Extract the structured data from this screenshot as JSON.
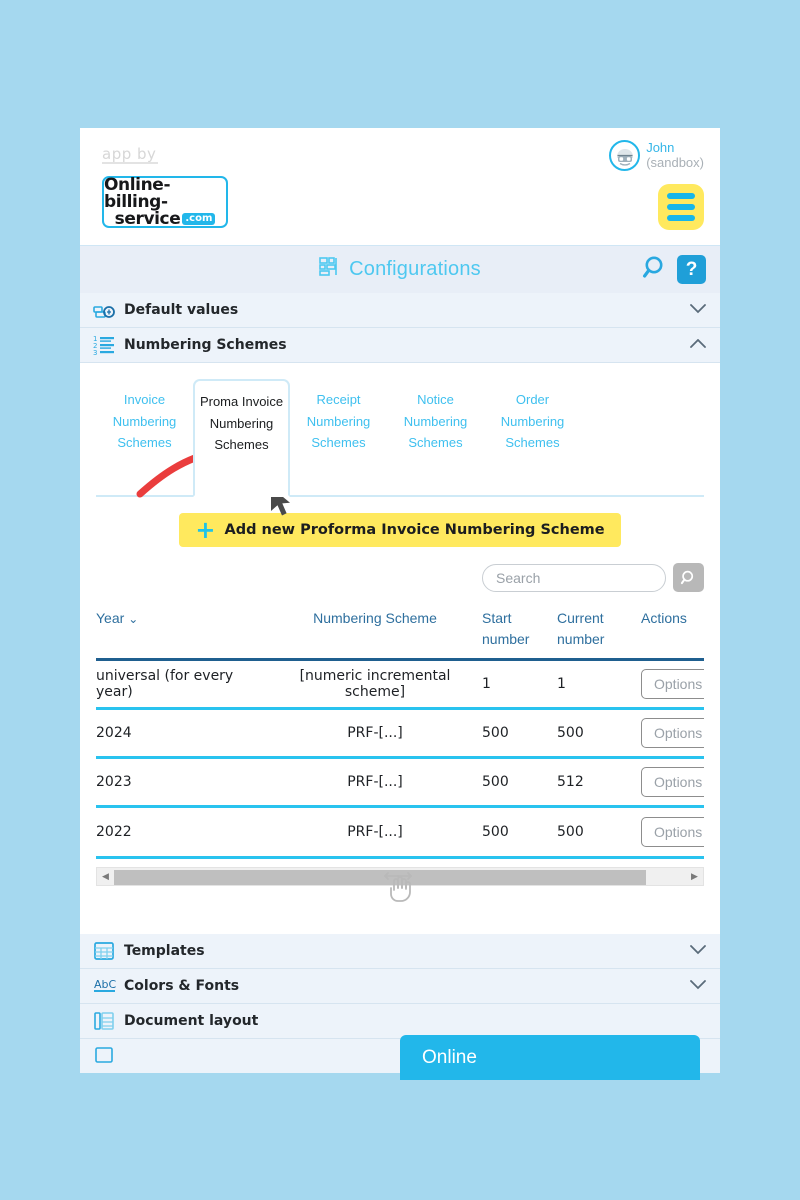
{
  "brand": {
    "app_by": "app by",
    "logo_line1": "Online-billing-",
    "logo_line2": "service",
    "logo_tld": ".com"
  },
  "user": {
    "name": "John",
    "mode": "(sandbox)",
    "avatar_icon": "user-face-icon",
    "menu_icon": "hamburger-menu-icon"
  },
  "configbar": {
    "title": "Configurations",
    "title_icon": "blocks-grid-icon",
    "search_icon": "magnifier-icon",
    "help_label": "?"
  },
  "sections": [
    {
      "label": "Default values",
      "icon": "default-values-icon",
      "expanded": false,
      "chevron": "⌄"
    },
    {
      "label": "Numbering Schemes",
      "icon": "numbered-list-icon",
      "expanded": true,
      "chevron": "⌃"
    },
    {
      "label": "Templates",
      "icon": "templates-grid-icon",
      "expanded": false,
      "chevron": "⌄"
    },
    {
      "label": "Colors & Fonts",
      "icon": "abc-colors-icon",
      "expanded": false,
      "chevron": "⌄"
    },
    {
      "label": "Document layout",
      "icon": "document-layout-icon",
      "expanded": false,
      "chevron": ""
    }
  ],
  "tabs": [
    {
      "label": "Invoice Numbering Schemes",
      "active": false
    },
    {
      "label": "Proma Invoice Numbering Schemes",
      "active": true
    },
    {
      "label": "Receipt Numbering Schemes",
      "active": false
    },
    {
      "label": "Notice Numbering Schemes",
      "active": false
    },
    {
      "label": "Order Numbering Schemes",
      "active": false
    }
  ],
  "add_button": {
    "label": "Add new Proforma Invoice Numbering Scheme",
    "icon": "plus-icon",
    "plus": "+"
  },
  "search": {
    "value": "",
    "placeholder": "Search",
    "button_icon": "magnifier-icon"
  },
  "table": {
    "headers": {
      "year": "Year",
      "scheme": "Numbering Scheme",
      "start": "Start number",
      "current": "Current number",
      "actions": "Actions"
    },
    "sort_caret": "⌄",
    "rows": [
      {
        "year": "universal (for every year)",
        "scheme": "[numeric incremental scheme]",
        "start": "1",
        "current": "1",
        "action": "Options"
      },
      {
        "year": "2024",
        "scheme": "PRF-[...]",
        "start": "500",
        "current": "500",
        "action": "Options"
      },
      {
        "year": "2023",
        "scheme": "PRF-[...]",
        "start": "500",
        "current": "512",
        "action": "Options"
      },
      {
        "year": "2022",
        "scheme": "PRF-[...]",
        "start": "500",
        "current": "500",
        "action": "Options"
      }
    ]
  },
  "scrollbar": {
    "left_arrow": "◀",
    "right_arrow": "▶"
  },
  "chat": {
    "label": "Online"
  },
  "colors": {
    "page_background": "#a5d8ef",
    "accent_cyan": "#22b7ea",
    "tab_link": "#3fc0ef",
    "accent_yellow": "#ffe95e",
    "row_divider": "#29c3ef",
    "header_text": "#2e6f9e",
    "section_background": "#edf3fa",
    "annotation_red": "#ea3d3d"
  }
}
